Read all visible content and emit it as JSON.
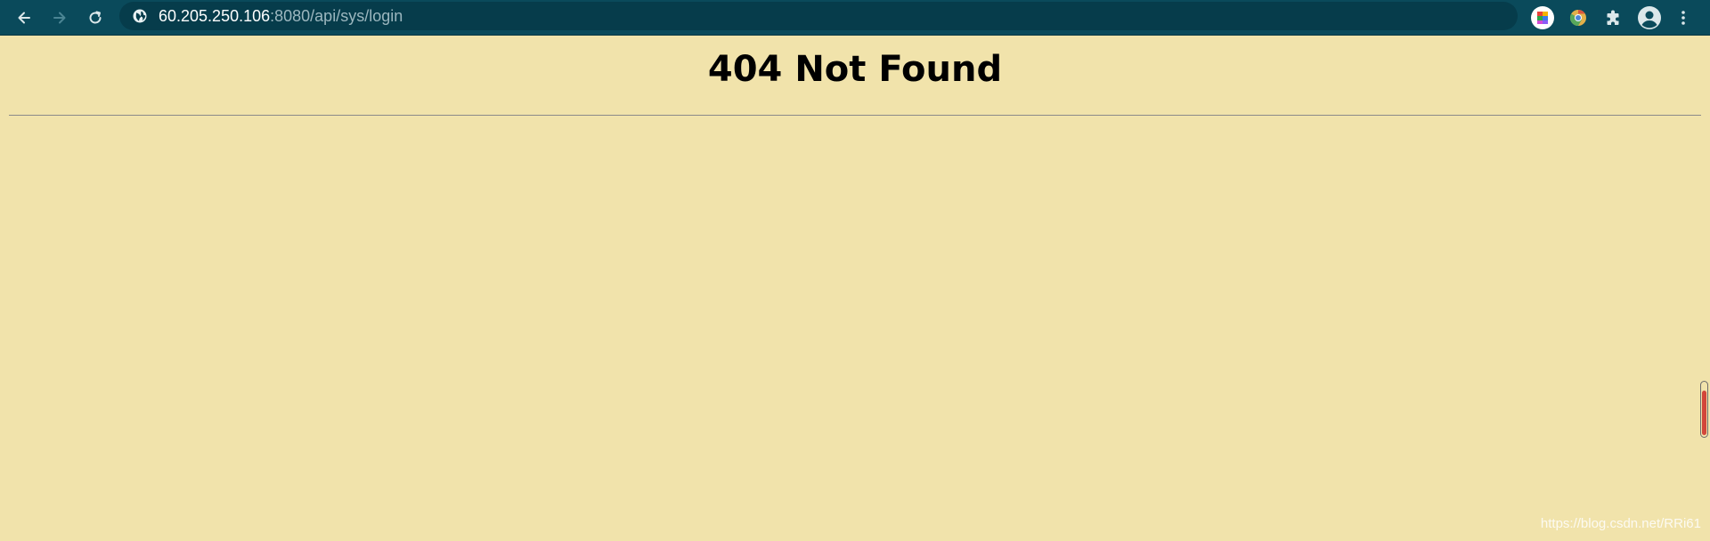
{
  "browser": {
    "nav": {
      "back_icon": "arrow-left-icon",
      "forward_icon": "arrow-right-icon",
      "reload_icon": "reload-icon"
    },
    "address_bar": {
      "site_icon": "globe-icon",
      "host": "60.205.250.106",
      "rest": ":8080/api/sys/login"
    },
    "extensions": [
      {
        "name": "color-grid-extension-icon"
      },
      {
        "name": "chrome-extension-icon"
      },
      {
        "name": "puzzle-icon"
      },
      {
        "name": "profile-avatar-icon"
      },
      {
        "name": "kebab-menu-icon"
      }
    ],
    "colors": {
      "toolbar": "#0a4a5b",
      "omnibox": "#063c4b",
      "page_background": "#f1e3ab"
    }
  },
  "page": {
    "title": "404 Not Found",
    "watermark": "https://blog.csdn.net/RRi61"
  }
}
